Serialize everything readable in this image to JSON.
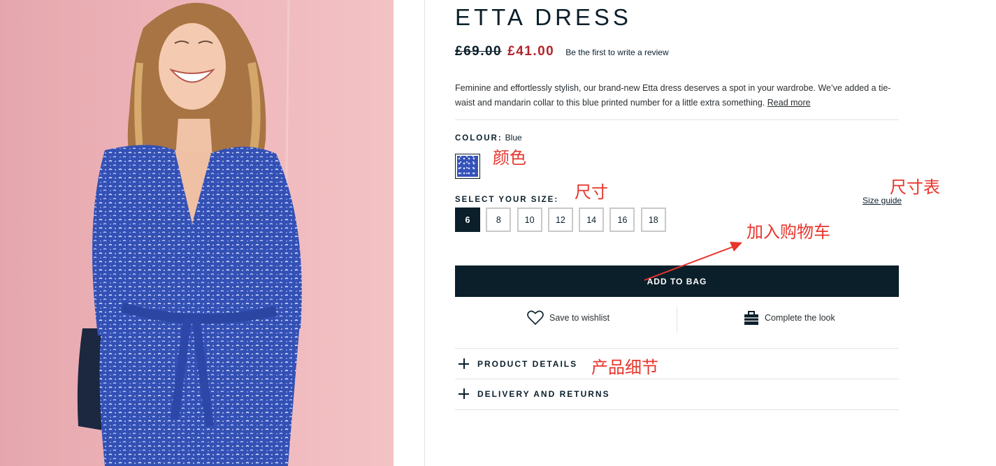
{
  "product": {
    "title": "ETTA DRESS",
    "old_price": "£69.00",
    "price": "£41.00",
    "review_link": "Be the first to write a review",
    "description": "Feminine and effortlessly stylish, our brand-new Etta dress deserves a spot in your wardrobe. We’ve added a tie-waist and mandarin collar to this blue printed number for a little extra something.",
    "read_more": "Read more"
  },
  "colour": {
    "label": "COLOUR:",
    "value": "Blue",
    "swatch_color": "#3452b8"
  },
  "size": {
    "label": "SELECT YOUR SIZE:",
    "guide_link": "Size guide",
    "options": [
      "6",
      "8",
      "10",
      "12",
      "14",
      "16",
      "18"
    ],
    "selected": "6"
  },
  "add_to_bag": "ADD TO BAG",
  "actions": {
    "wishlist": "Save to wishlist",
    "complete_look": "Complete the look"
  },
  "accordions": {
    "product_details": "PRODUCT DETAILS",
    "delivery_returns": "DELIVERY AND RETURNS"
  },
  "annotations": {
    "colour": "颜色",
    "size": "尺寸",
    "size_chart": "尺寸表",
    "add_to_cart": "加入购物车",
    "product_details": "产品细节"
  },
  "colors": {
    "accent": "#0b1f2a",
    "sale": "#b3242c",
    "annotation": "#e8352c"
  }
}
